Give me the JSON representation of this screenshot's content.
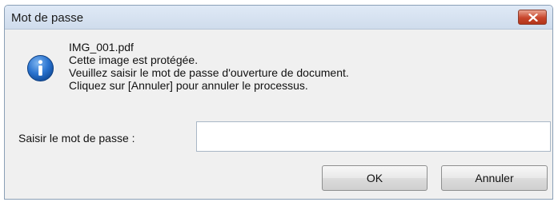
{
  "dialog": {
    "title": "Mot de passe",
    "close_icon": "close-icon",
    "info_icon": "info-icon",
    "message_lines": [
      "IMG_001.pdf",
      "Cette image est protégée.",
      "Veuillez saisir le mot de passe d'ouverture de document.",
      "Cliquez sur [Annuler] pour annuler le processus."
    ],
    "password_label": "Saisir le mot de passe :",
    "password_value": "",
    "ok_label": "OK",
    "cancel_label": "Annuler"
  },
  "colors": {
    "titlebar": "#d6e2f1",
    "close_button": "#c8462c",
    "dialog_background": "#f0f0f0",
    "info_icon": "#1f66c1"
  }
}
